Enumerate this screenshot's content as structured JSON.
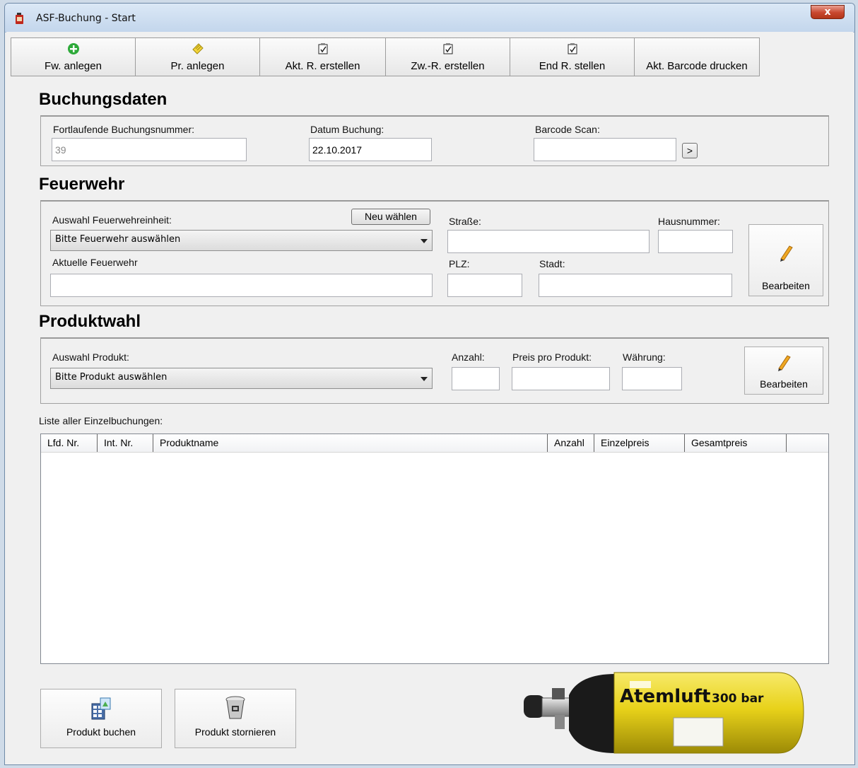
{
  "window": {
    "title": "ASF-Buchung - Start",
    "close_label": "x"
  },
  "toolbar": [
    {
      "label": "Fw. anlegen",
      "icon": "add-icon"
    },
    {
      "label": "Pr. anlegen",
      "icon": "notes-icon"
    },
    {
      "label": "Akt. R. erstellen",
      "icon": "checklist-icon"
    },
    {
      "label": "Zw.-R. erstellen",
      "icon": "checklist-icon"
    },
    {
      "label": "End R. stellen",
      "icon": "checklist-icon"
    },
    {
      "label": "Akt. Barcode drucken",
      "icon": ""
    }
  ],
  "buchungsdaten": {
    "title": "Buchungsdaten",
    "nummer_label": "Fortlaufende Buchungsnummer:",
    "nummer_value": "39",
    "datum_label": "Datum Buchung:",
    "datum_value": "22.10.2017",
    "barcode_label": "Barcode Scan:",
    "barcode_value": "",
    "barcode_button": ">"
  },
  "feuerwehr": {
    "title": "Feuerwehr",
    "auswahl_label": "Auswahl Feuerwehreinheit:",
    "neu_button": "Neu wählen",
    "auswahl_value": "Bitte Feuerwehr auswählen",
    "aktuelle_label": "Aktuelle Feuerwehr",
    "aktuelle_value": "",
    "strasse_label": "Straße:",
    "strasse_value": "",
    "hausnummer_label": "Hausnummer:",
    "hausnummer_value": "",
    "plz_label": "PLZ:",
    "plz_value": "",
    "stadt_label": "Stadt:",
    "stadt_value": "",
    "edit_button": "Bearbeiten"
  },
  "produktwahl": {
    "title": "Produktwahl",
    "auswahl_label": "Auswahl Produkt:",
    "auswahl_value": "Bitte Produkt auswählen",
    "anzahl_label": "Anzahl:",
    "anzahl_value": "",
    "preis_label": "Preis pro Produkt:",
    "preis_value": "",
    "waehrung_label": "Währung:",
    "waehrung_value": "",
    "edit_button": "Bearbeiten"
  },
  "liste": {
    "label": "Liste aller Einzelbuchungen:",
    "columns": [
      "Lfd. Nr.",
      "Int. Nr.",
      "Produktname",
      "Anzahl",
      "Einzelpreis",
      "Gesamtpreis",
      ""
    ],
    "rows": []
  },
  "actions": {
    "buchen": "Produkt buchen",
    "stornieren": "Produkt stornieren"
  },
  "tank": {
    "text_main": "Atemluft",
    "text_pressure": "300 bar"
  },
  "colors": {
    "tank_yellow": "#e8d21a",
    "title_bar": "#c9dbef",
    "close_red": "#c8472e"
  }
}
